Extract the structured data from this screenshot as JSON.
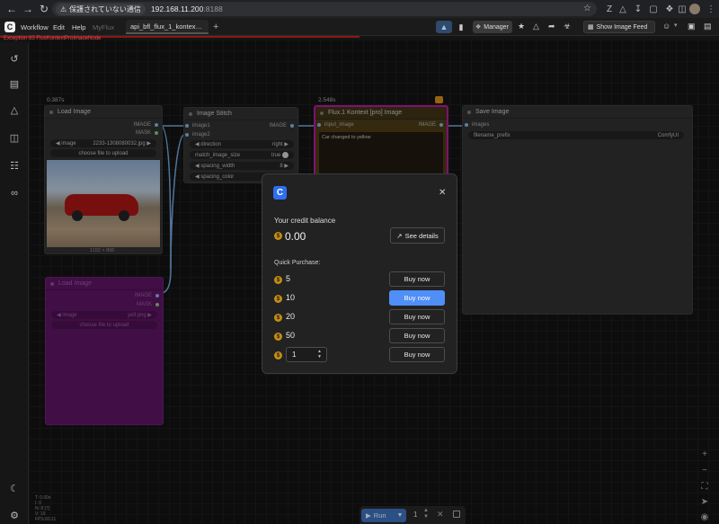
{
  "browser": {
    "security_label": "保護されていない通信",
    "host": "192.168.11.200",
    "port": ":8188"
  },
  "app": {
    "menu": [
      "Workflow",
      "Edit",
      "Help"
    ],
    "tabs": [
      {
        "label": "MyFlux"
      },
      {
        "label": "api_bfl_flux_1_kontex…"
      }
    ],
    "manager_label": "Manager",
    "show_feed_label": "Show Image Feed",
    "error_text": "Exception 83 FluxKontextProImageNode"
  },
  "nodes": {
    "load_image": {
      "time": "0.387s",
      "title": "Load Image",
      "out_image": "IMAGE",
      "out_mask": "MASK",
      "image_label": "image",
      "image_value": "2233-1308080032.jpg",
      "upload_label": "choose file to upload",
      "size_label": "1152 × 896"
    },
    "image_stitch": {
      "title": "Image Stitch",
      "in_image1": "image1",
      "in_image2": "image2",
      "out_image": "IMAGE",
      "widgets": [
        {
          "label": "direction",
          "value": "right"
        },
        {
          "label": "match_image_size",
          "value": "true"
        },
        {
          "label": "spacing_width",
          "value": "8"
        },
        {
          "label": "spacing_color",
          "value": ""
        }
      ]
    },
    "flux": {
      "time": "2.548s",
      "title": "Flux.1 Kontext [pro] Image",
      "in_image": "input_image",
      "out_image": "IMAGE",
      "prompt": "Car changed to yellow"
    },
    "save_image": {
      "title": "Save Image",
      "in_images": "images",
      "prefix_label": "filename_prefix",
      "prefix_value": "ComfyUI"
    },
    "load_image_2": {
      "title": "Load Image",
      "out_image": "IMAGE",
      "out_mask": "MASK",
      "image_label": "image",
      "image_value": "yell.png",
      "upload_label": "choose file to upload"
    }
  },
  "modal": {
    "balance_label": "Your credit balance",
    "balance_value": "0.00",
    "see_details_label": "See details",
    "quick_purchase_label": "Quick Purchase:",
    "options": [
      {
        "amount": "5",
        "button": "Buy now"
      },
      {
        "amount": "10",
        "button": "Buy now"
      },
      {
        "amount": "20",
        "button": "Buy now"
      },
      {
        "amount": "50",
        "button": "Buy now"
      }
    ],
    "custom_value": "1",
    "custom_button": "Buy now",
    "currency_symbol": "$"
  },
  "bottom": {
    "run_label": "Run",
    "queue_count": "1"
  },
  "stats": [
    "T: 0.00s",
    "I: 0",
    "N: 8 [7]",
    "V: 19",
    "FPS:60.11"
  ],
  "colors": {
    "accent": "#3b82f6",
    "highlight_button": "#4f8ff7",
    "flux_border": "#b5179e",
    "error": "#e24a4a",
    "coin": "#c78d12",
    "purple_node": "#5a1462"
  }
}
